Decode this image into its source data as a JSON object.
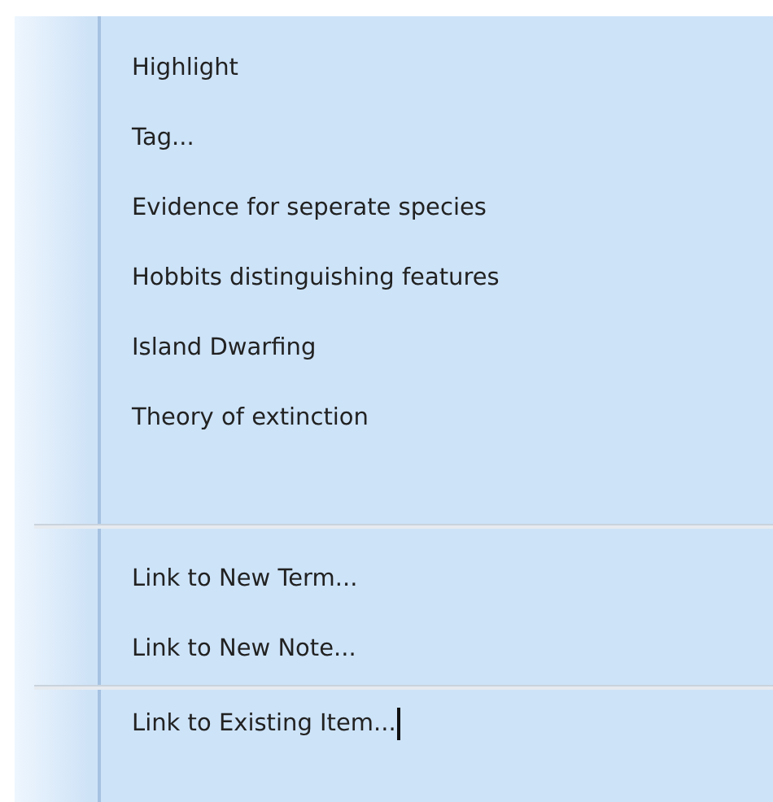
{
  "menu": {
    "groups": [
      {
        "items": [
          {
            "label": "Highlight"
          },
          {
            "label": "Tag..."
          },
          {
            "label": "Evidence for seperate species"
          },
          {
            "label": "Hobbits distinguishing features"
          },
          {
            "label": "Island Dwarfing"
          },
          {
            "label": "Theory of extinction"
          }
        ]
      },
      {
        "items": [
          {
            "label": "Link to New Term..."
          },
          {
            "label": "Link to New Note..."
          }
        ]
      },
      {
        "items": [
          {
            "label": "Link to Existing Item..."
          }
        ]
      }
    ]
  }
}
